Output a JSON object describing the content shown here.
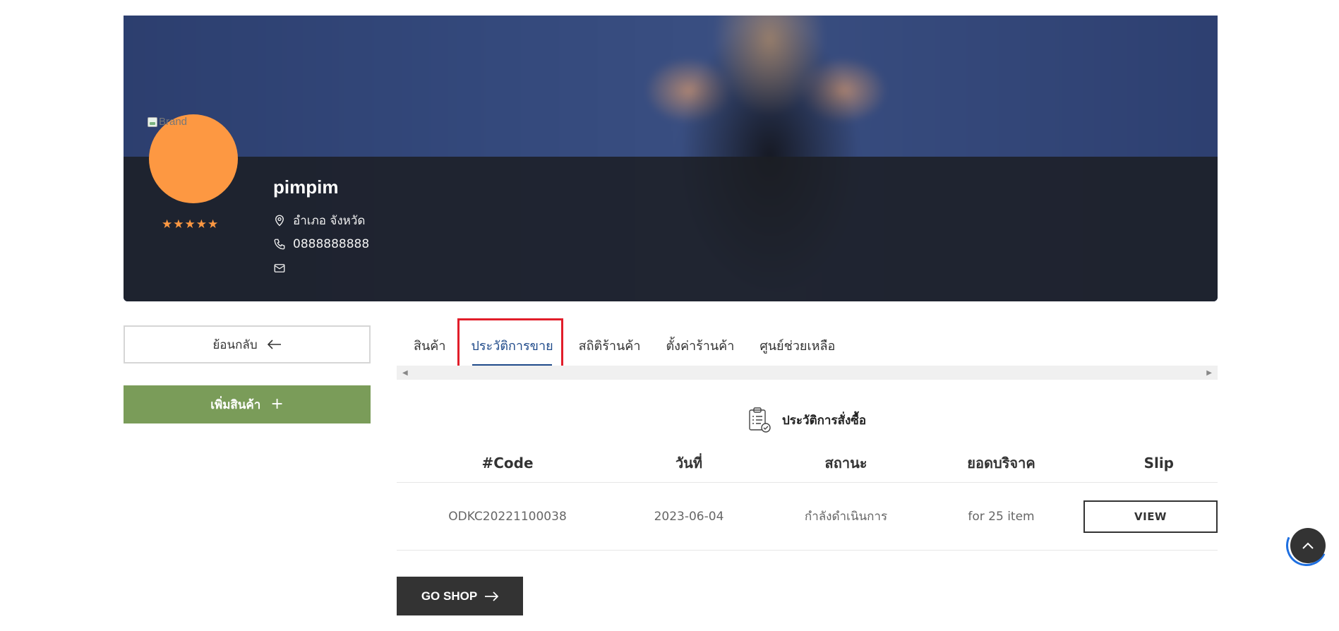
{
  "shop": {
    "avatar_alt": "Brand",
    "avatar_color": "#fd9842",
    "rating": 5,
    "stars": "★★★★★",
    "name": "pimpim",
    "location": "อำเภอ จังหวัด",
    "phone": "0888888888",
    "email": ""
  },
  "sidebar": {
    "back_label": "ย้อนกลับ",
    "add_product_label": "เพิ่มสินค้า"
  },
  "tabs": [
    {
      "label": "สินค้า",
      "active": false
    },
    {
      "label": "ประวัติการขาย",
      "active": true
    },
    {
      "label": "สถิติร้านค้า",
      "active": false
    },
    {
      "label": "ตั้งค่าร้านค้า",
      "active": false
    },
    {
      "label": "ศูนย์ช่วยเหลือ",
      "active": false
    }
  ],
  "history": {
    "title": "ประวัติการสั่งซื้อ",
    "columns": [
      "#Code",
      "วันที่",
      "สถานะ",
      "ยอดบริจาค",
      "Slip"
    ],
    "rows": [
      {
        "code": "ODKC20221100038",
        "date": "2023-06-04",
        "status": "กำลังดำเนินการ",
        "amount": "for 25 item",
        "slip_label": "VIEW"
      }
    ]
  },
  "go_shop_label": "GO SHOP",
  "colors": {
    "accent_blue": "#1f4a8a",
    "add_green": "#7a9c59",
    "star_orange": "#fd9842",
    "highlight_red": "#e11d2a",
    "dark": "#333333"
  }
}
